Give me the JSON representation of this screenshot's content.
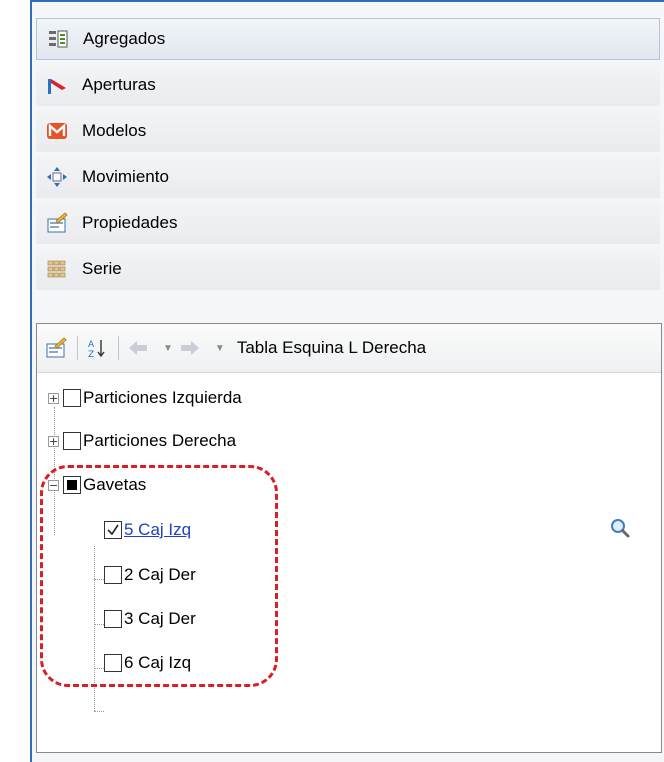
{
  "nav": {
    "items": [
      {
        "label": "Agregados",
        "icon": "list-icon",
        "selected": true
      },
      {
        "label": "Aperturas",
        "icon": "opening-icon"
      },
      {
        "label": "Modelos",
        "icon": "model-icon"
      },
      {
        "label": "Movimiento",
        "icon": "move-icon"
      },
      {
        "label": "Propiedades",
        "icon": "properties-icon"
      },
      {
        "label": "Serie",
        "icon": "grid-icon"
      }
    ]
  },
  "toolbar": {
    "title": "Tabla Esquina L Derecha",
    "icons": [
      "properties-icon",
      "sort-az-icon",
      "back-arrow-icon",
      "forward-arrow-icon"
    ]
  },
  "tree": {
    "nodes": [
      {
        "label": "Particiones Izquierda",
        "expander": "+",
        "state": "unchecked"
      },
      {
        "label": "Particiones Derecha",
        "expander": "+",
        "state": "unchecked"
      },
      {
        "label": "Gavetas",
        "expander": "−",
        "state": "mixed",
        "children": [
          {
            "label": "5 Caj Izq",
            "state": "checked",
            "link": true
          },
          {
            "label": "2 Caj Der",
            "state": "unchecked"
          },
          {
            "label": "3 Caj Der",
            "state": "unchecked"
          },
          {
            "label": "6 Caj Izq",
            "state": "unchecked"
          }
        ]
      }
    ]
  },
  "colors": {
    "accent": "#2f6fb8",
    "highlight": "#d81f26",
    "link": "#1e40c8"
  }
}
